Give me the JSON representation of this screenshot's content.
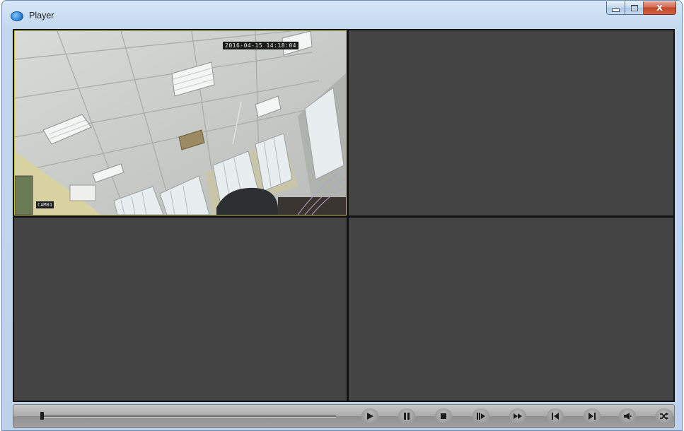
{
  "window": {
    "title": "Player",
    "icon": "player-icon",
    "controls": {
      "minimize_icon": "minimize-icon",
      "maximize_icon": "maximize-icon",
      "close_icon": "close-icon",
      "close_glyph": "x"
    }
  },
  "colors": {
    "cell_background": "#444444",
    "grid_gap": "#111111",
    "active_cell_border": "#c6c44a",
    "control_bar": "#a9a9a9",
    "icon": "#1c1c1c"
  },
  "video_grid": {
    "layout": "2x2",
    "cells": [
      {
        "name": "camera-cell-1",
        "active": true,
        "has_video": true,
        "osd_timestamp": "2016-04-15 14:18:04",
        "osd_camera": "CAM01"
      },
      {
        "name": "camera-cell-2",
        "active": false,
        "has_video": false
      },
      {
        "name": "camera-cell-3",
        "active": false,
        "has_video": false
      },
      {
        "name": "camera-cell-4",
        "active": false,
        "has_video": false
      }
    ]
  },
  "playback": {
    "position": 0.0,
    "buttons": [
      {
        "name": "play-button",
        "icon": "play-icon"
      },
      {
        "name": "pause-button",
        "icon": "pause-icon"
      },
      {
        "name": "stop-button",
        "icon": "stop-icon"
      },
      {
        "name": "step-forward-button",
        "icon": "step-forward-icon"
      },
      {
        "name": "fast-forward-button",
        "icon": "fast-forward-icon"
      },
      {
        "name": "previous-button",
        "icon": "skip-to-start-icon"
      },
      {
        "name": "next-button",
        "icon": "skip-to-end-icon"
      },
      {
        "name": "volume-button",
        "icon": "speaker-icon"
      },
      {
        "name": "shuffle-button",
        "icon": "shuffle-icon"
      }
    ]
  }
}
